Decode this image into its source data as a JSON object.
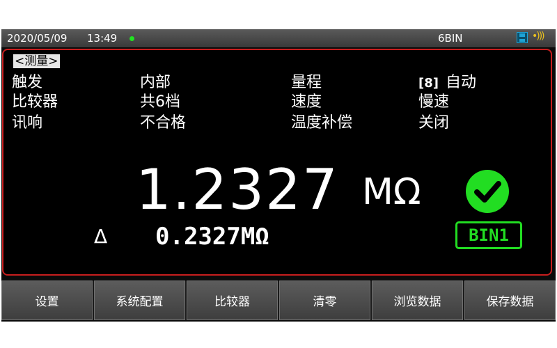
{
  "status_bar": {
    "date": "2020/05/09",
    "time": "13:49",
    "bin_label": "6BIN",
    "icons": [
      "status-dot-icon",
      "save-icon",
      "sound-icon"
    ]
  },
  "panel": {
    "mode_label": "<测量>",
    "rows": [
      {
        "k1": "触发",
        "v1": "内部",
        "k2": "量程",
        "v2_tag": "[8]",
        "v2": "自动"
      },
      {
        "k1": "比较器",
        "v1": "共6档",
        "k2": "速度",
        "v2": "慢速"
      },
      {
        "k1": "讯响",
        "v1": "不合格",
        "k2": "温度补偿",
        "v2": "关闭"
      }
    ],
    "reading": "1.2327",
    "reading_unit": "MΩ",
    "delta_symbol": "Δ",
    "delta_value": "0.2327MΩ",
    "bin_result": "BIN1",
    "ok_icon": "check-circle-icon"
  },
  "softkeys": [
    {
      "label": "设置"
    },
    {
      "label": "系统配置"
    },
    {
      "label": "比较器"
    },
    {
      "label": "清零"
    },
    {
      "label": "浏览数据"
    },
    {
      "label": "保存数据"
    }
  ],
  "colors": {
    "panel_border": "#c81e1e",
    "pass_green": "#22dd22",
    "status_bar": "#4a4a4a"
  }
}
